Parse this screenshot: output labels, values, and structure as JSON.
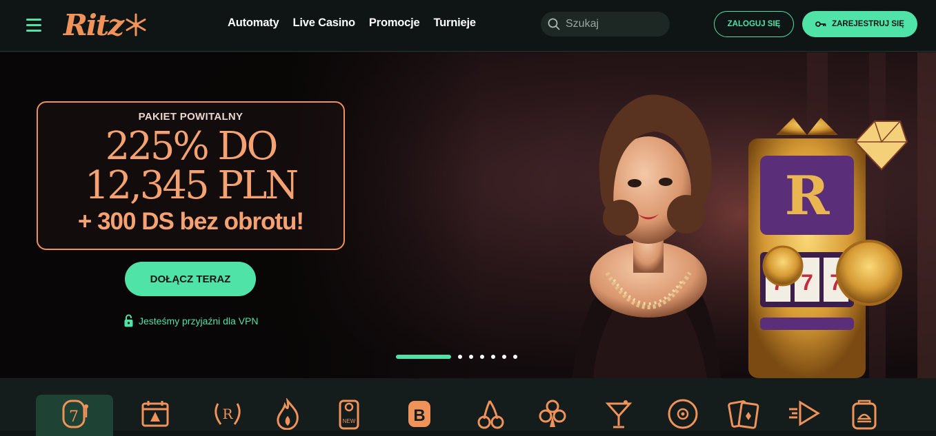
{
  "header": {
    "logo_text": "Ritz",
    "nav": [
      "Automaty",
      "Live Casino",
      "Promocje",
      "Turnieje"
    ],
    "search_placeholder": "Szukaj",
    "login_label": "ZALOGUJ SIĘ",
    "register_label": "ZAREJESTRUJ SIĘ"
  },
  "hero": {
    "kicker": "PAKIET POWITALNY",
    "line1": "225% DO",
    "line2": "12,345 PLN",
    "subline": "+ 300 DS bez obrotu!",
    "cta_label": "DOŁĄCZ TERAZ",
    "vpn_text": "Jesteśmy przyjaźni dla VPN",
    "slides_total": 7,
    "slide_active": 1
  },
  "categories": [
    {
      "icon": "slot-seven-icon",
      "active": true
    },
    {
      "icon": "calendar-tree-icon",
      "active": false
    },
    {
      "icon": "laurel-r-icon",
      "active": false
    },
    {
      "icon": "flame-icon",
      "active": false
    },
    {
      "icon": "door-hanger-new-icon",
      "active": false
    },
    {
      "icon": "b-badge-icon",
      "active": false
    },
    {
      "icon": "cherries-icon",
      "active": false
    },
    {
      "icon": "club-suit-icon",
      "active": false
    },
    {
      "icon": "cocktail-icon",
      "active": false
    },
    {
      "icon": "chip-icon",
      "active": false
    },
    {
      "icon": "cards-icon",
      "active": false
    },
    {
      "icon": "fast-play-icon",
      "active": false
    },
    {
      "icon": "jackpot-icon",
      "active": false
    }
  ],
  "colors": {
    "accent": "#4fe3a8",
    "brand": "#f0935a",
    "background": "#0f1514"
  }
}
